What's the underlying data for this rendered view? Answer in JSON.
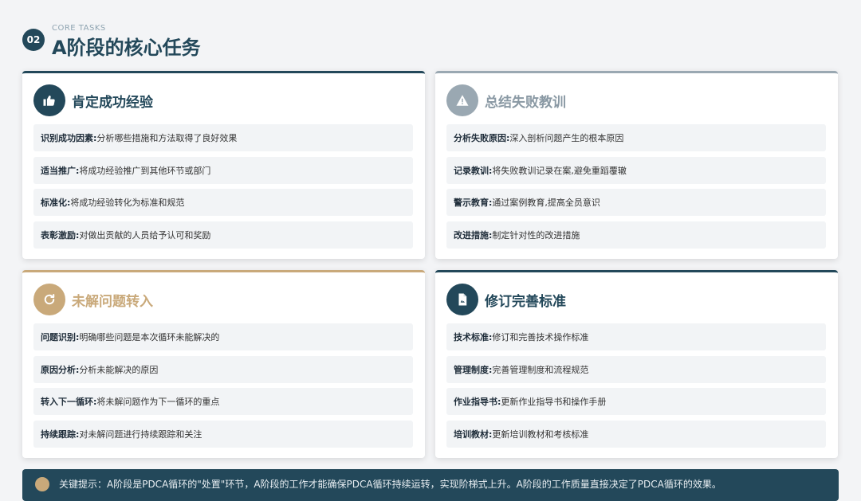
{
  "header": {
    "number": "02",
    "eyebrow": "CORE TASKS",
    "title": "A阶段的核心任务"
  },
  "colors": {
    "primary": "#23485a",
    "muted": "#9aa8b2",
    "accent": "#c9a97a"
  },
  "cards": [
    {
      "title": "肯定成功经验",
      "icon": "thumbs-up-icon",
      "items": [
        {
          "label": "识别成功因素:",
          "text": " 分析哪些措施和方法取得了良好效果"
        },
        {
          "label": "适当推广:",
          "text": " 将成功经验推广到其他环节或部门"
        },
        {
          "label": "标准化:",
          "text": " 将成功经验转化为标准和规范"
        },
        {
          "label": "表彰激励:",
          "text": " 对做出贡献的人员给予认可和奖励"
        }
      ]
    },
    {
      "title": "总结失败教训",
      "icon": "warning-icon",
      "items": [
        {
          "label": "分析失败原因:",
          "text": " 深入剖析问题产生的根本原因"
        },
        {
          "label": "记录教训:",
          "text": " 将失败教训记录在案,避免重蹈覆辙"
        },
        {
          "label": "警示教育:",
          "text": " 通过案例教育,提高全员意识"
        },
        {
          "label": "改进措施:",
          "text": " 制定针对性的改进措施"
        }
      ]
    },
    {
      "title": "未解问题转入",
      "icon": "redo-icon",
      "items": [
        {
          "label": "问题识别:",
          "text": " 明确哪些问题是本次循环未能解决的"
        },
        {
          "label": "原因分析:",
          "text": " 分析未能解决的原因"
        },
        {
          "label": "转入下一循环:",
          "text": " 将未解问题作为下一循环的重点"
        },
        {
          "label": "持续跟踪:",
          "text": " 对未解问题进行持续跟踪和关注"
        }
      ]
    },
    {
      "title": "修订完善标准",
      "icon": "document-icon",
      "items": [
        {
          "label": "技术标准:",
          "text": " 修订和完善技术操作标准"
        },
        {
          "label": "管理制度:",
          "text": " 完善管理制度和流程规范"
        },
        {
          "label": "作业指导书:",
          "text": " 更新作业指导书和操作手册"
        },
        {
          "label": "培训教材:",
          "text": " 更新培训教材和考核标准"
        }
      ]
    }
  ],
  "note": {
    "text": "关键提示：A阶段是PDCA循环的\"处置\"环节，A阶段的工作才能确保PDCA循环持续运转，实现阶梯式上升。A阶段的工作质量直接决定了PDCA循环的效果。"
  }
}
